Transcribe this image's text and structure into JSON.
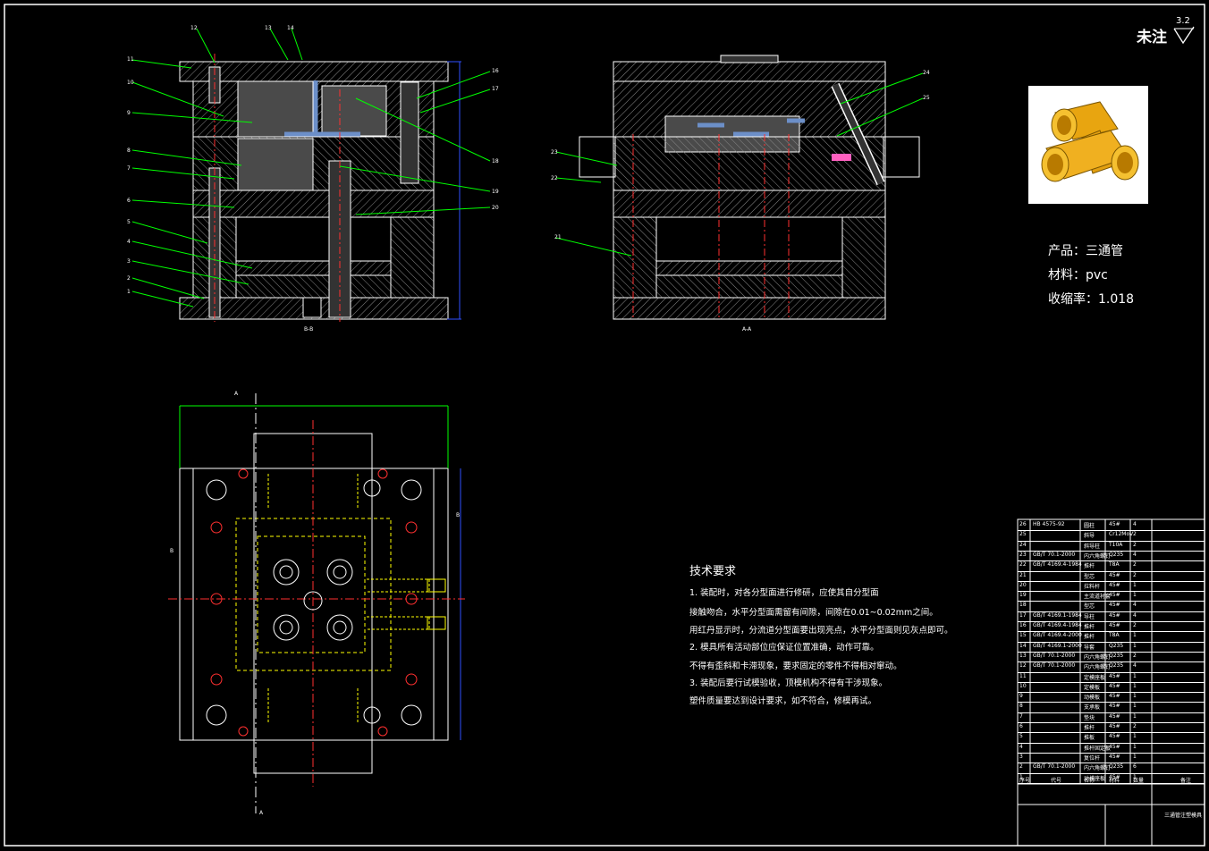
{
  "header": {
    "corner_note": "未注",
    "roughness": "3.2"
  },
  "product": {
    "name": "产品：三通管",
    "material": "材料：pvc",
    "shrinkage": "收缩率：1.018"
  },
  "tech_requirements": {
    "title": "技术要求",
    "lines": [
      "1. 装配时，对各分型面进行修研，应使其自分型面",
      "接触吻合，水平分型面需留有间隙，间隙在0.01~0.02mm之间。",
      "用红丹显示时，分流道分型面要出现亮点，水平分型面则见灰点即可。",
      "2. 模具所有活动部位应保证位置准确，动作可靠。",
      "不得有歪斜和卡滞现象，要求固定的零件不得相对窜动。",
      "3. 装配后要行试模验收，顶模机构不得有干涉现象。",
      "塑件质量要达到设计要求，如不符合，修模再试。"
    ]
  },
  "view_labels": {
    "section_bb": "B-B",
    "section_aa": "A-A",
    "cut_a": "A",
    "cut_b": "B"
  },
  "part_numbers_left": [
    "1",
    "2",
    "3",
    "4",
    "5",
    "6",
    "7",
    "8",
    "9",
    "10",
    "11",
    "12",
    "13",
    "14",
    "16",
    "17",
    "18",
    "19",
    "20"
  ],
  "part_numbers_mid": [
    "21",
    "22",
    "23",
    "24",
    "25"
  ],
  "bom": {
    "rows": [
      {
        "no": "26",
        "code": "HB 4575-92",
        "name": "圆柱",
        "mat": "45#",
        "qty": "4"
      },
      {
        "no": "25",
        "code": "",
        "name": "斜导",
        "mat": "Cr12MoV",
        "qty": "2"
      },
      {
        "no": "24",
        "code": "",
        "name": "斜导柱",
        "mat": "T10A",
        "qty": "2"
      },
      {
        "no": "23",
        "code": "GB/T 70.1-2000",
        "name": "内六角螺钉",
        "mat": "Q235",
        "qty": "4"
      },
      {
        "no": "22",
        "code": "GB/T 4169.4-1984",
        "name": "推杆",
        "mat": "T8A",
        "qty": "2"
      },
      {
        "no": "21",
        "code": "",
        "name": "型芯",
        "mat": "45#",
        "qty": "2"
      },
      {
        "no": "20",
        "code": "",
        "name": "拉料杆",
        "mat": "45#",
        "qty": "1"
      },
      {
        "no": "19",
        "code": "",
        "name": "主流道衬套",
        "mat": "45#",
        "qty": "1"
      },
      {
        "no": "18",
        "code": "",
        "name": "型芯",
        "mat": "45#",
        "qty": "4"
      },
      {
        "no": "17",
        "code": "GB/T 4169.1-1984",
        "name": "导柱",
        "mat": "45#",
        "qty": "4"
      },
      {
        "no": "16",
        "code": "GB/T 4169.4-1984",
        "name": "推杆",
        "mat": "45#",
        "qty": "2"
      },
      {
        "no": "15",
        "code": "GB/T 4169.4-2000",
        "name": "推杆",
        "mat": "T8A",
        "qty": "1"
      },
      {
        "no": "14",
        "code": "GB/T 4169.1-2000",
        "name": "导套",
        "mat": "Q235",
        "qty": "1"
      },
      {
        "no": "13",
        "code": "GB/T 70.1-2000",
        "name": "内六角螺钉",
        "mat": "Q235",
        "qty": "2"
      },
      {
        "no": "12",
        "code": "GB/T 70.1-2000",
        "name": "内六角螺钉",
        "mat": "Q235",
        "qty": "4"
      },
      {
        "no": "11",
        "code": "",
        "name": "定模座板",
        "mat": "45#",
        "qty": "1"
      },
      {
        "no": "10",
        "code": "",
        "name": "定模板",
        "mat": "45#",
        "qty": "1"
      },
      {
        "no": "9",
        "code": "",
        "name": "动模板",
        "mat": "45#",
        "qty": "1"
      },
      {
        "no": "8",
        "code": "",
        "name": "支承板",
        "mat": "45#",
        "qty": "1"
      },
      {
        "no": "7",
        "code": "",
        "name": "垫块",
        "mat": "45#",
        "qty": "1"
      },
      {
        "no": "6",
        "code": "",
        "name": "推杆",
        "mat": "45#",
        "qty": "2"
      },
      {
        "no": "5",
        "code": "",
        "name": "推板",
        "mat": "45#",
        "qty": "1"
      },
      {
        "no": "4",
        "code": "",
        "name": "推杆固定板",
        "mat": "45#",
        "qty": "1"
      },
      {
        "no": "3",
        "code": "",
        "name": "复位杆",
        "mat": "45#",
        "qty": "1"
      },
      {
        "no": "2",
        "code": "GB/T 70.1-2000",
        "name": "内六角螺钉",
        "mat": "Q235",
        "qty": "6"
      },
      {
        "no": "1",
        "code": "",
        "name": "动模座板",
        "mat": "45#",
        "qty": "1"
      }
    ],
    "header": {
      "no": "序号",
      "code": "代号",
      "name": "名称",
      "mat": "材料",
      "qty": "数量",
      "note": "备注"
    },
    "title_block": "三通管注塑模具"
  },
  "colors": {
    "background": "#000000",
    "frame": "#ffffff",
    "leader": "#00ff00",
    "hidden": "#ffff00",
    "center": "#ff3030",
    "blue_dim": "#3050ff",
    "hatch": "#9a9a9a"
  }
}
